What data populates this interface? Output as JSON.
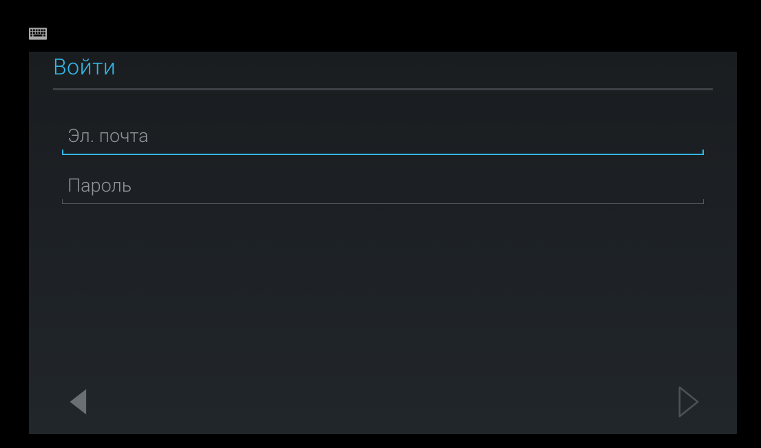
{
  "colors": {
    "accent": "#33b5e5",
    "background_top": "#191d20",
    "background_bottom": "#21262b",
    "placeholder": "#8f9499",
    "divider": "#3d4247",
    "input_border": "#555a5f"
  },
  "statusbar": {
    "keyboard_icon": "keyboard-icon"
  },
  "header": {
    "title": "Войти"
  },
  "form": {
    "email": {
      "placeholder": "Эл. почта",
      "value": "",
      "focused": true
    },
    "password": {
      "placeholder": "Пароль",
      "value": "",
      "focused": false
    }
  },
  "nav": {
    "back_label": "Back",
    "next_label": "Next"
  }
}
